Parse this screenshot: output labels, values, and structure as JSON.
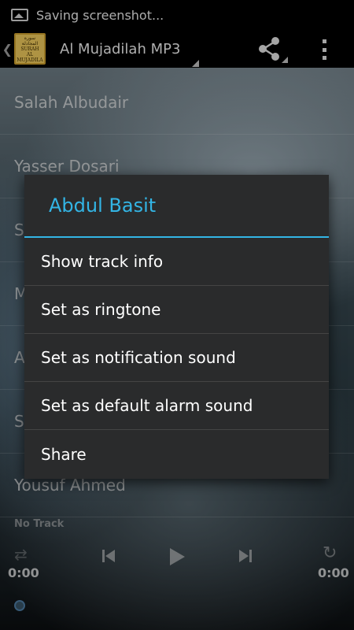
{
  "status_bar": {
    "notification_icon": "screenshot-icon",
    "text": "Saving screenshot..."
  },
  "action_bar": {
    "logo_lines": [
      "سورة المجادلة",
      "SURAH",
      "AL",
      "MUJADILA"
    ],
    "title": "Al Mujadilah MP3",
    "share_icon": "share-icon",
    "overflow_icon": "overflow-menu-icon"
  },
  "list": {
    "items": [
      "Salah Albudair",
      "Yasser Dosari",
      "S",
      "M",
      "A",
      "S",
      "Yousuf Ahmed"
    ]
  },
  "player": {
    "track_text": "No Track",
    "time_elapsed": "0:00",
    "time_total": "0:00",
    "icons": [
      "shuffle-icon",
      "previous-icon",
      "play-icon",
      "next-icon",
      "repeat-icon"
    ]
  },
  "dialog": {
    "title": "Abdul Basit",
    "items": [
      "Show track info",
      "Set as ringtone",
      "Set as notification sound",
      "Set as default alarm sound",
      "Share"
    ]
  },
  "colors": {
    "accent": "#33b5e5",
    "dialog_bg": "#2a2b2c",
    "bar_bg": "#000000"
  }
}
